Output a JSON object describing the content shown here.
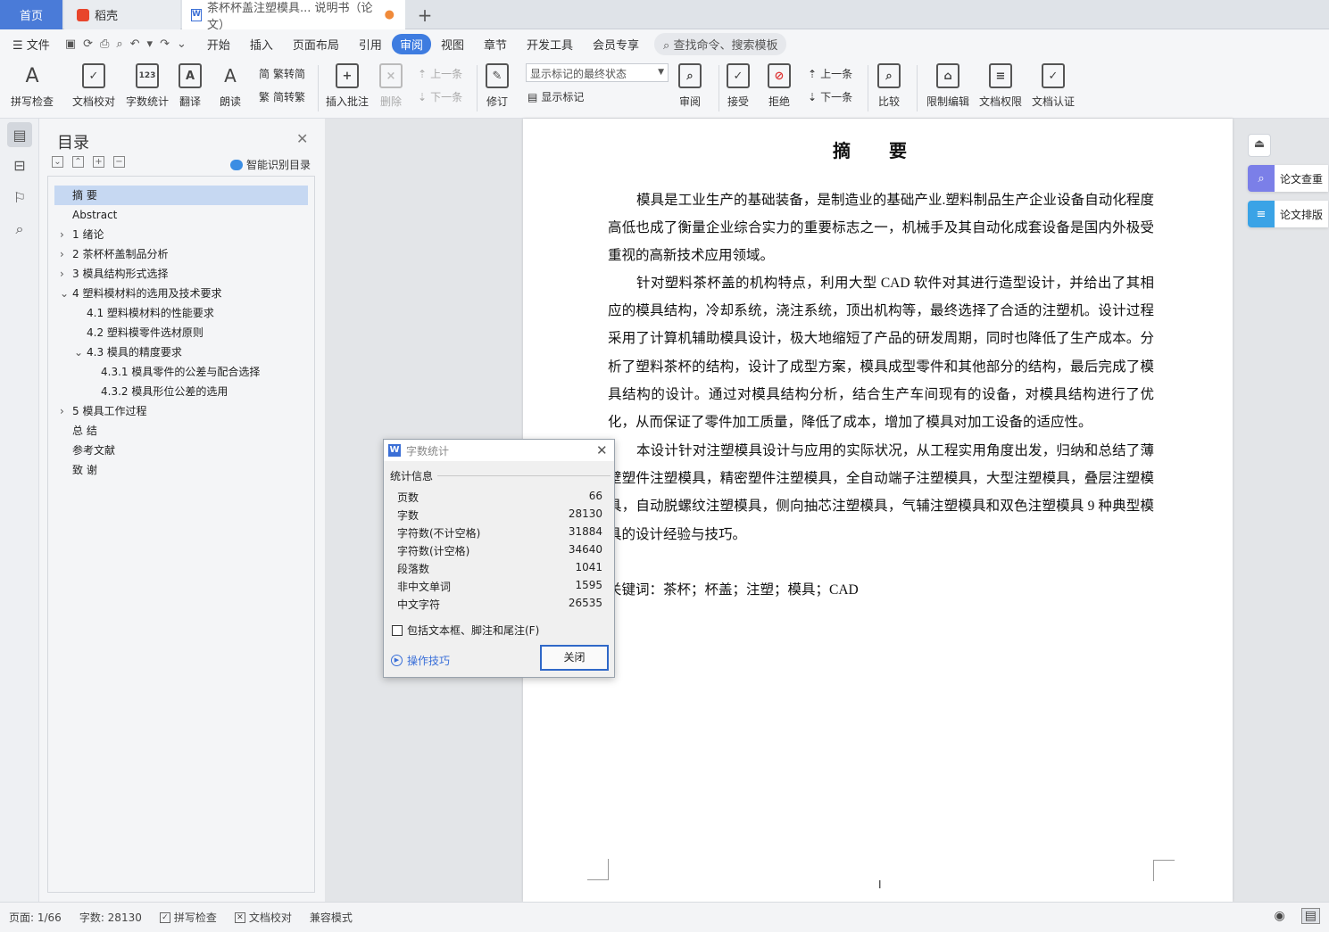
{
  "tabs": {
    "home": "首页",
    "daoke": "稻壳",
    "doc": "茶杯杯盖注塑模具... 说明书（论文）",
    "add": "+"
  },
  "menu": {
    "file": "文件",
    "items": [
      "开始",
      "插入",
      "页面布局",
      "引用",
      "审阅",
      "视图",
      "章节",
      "开发工具",
      "会员专享"
    ],
    "active": "审阅",
    "search": "查找命令、搜索模板"
  },
  "ribbon": {
    "spell": "拼写检查",
    "doc_check": "文档校对",
    "word_count": "字数统计",
    "translate": "翻译",
    "read": "朗读",
    "trad_to_simp": "繁转简",
    "simp_to_trad": "简转繁",
    "insert_comment": "插入批注",
    "delete": "删除",
    "prev": "上一条",
    "next": "下一条",
    "revise": "修订",
    "markup_mode": "显示标记的最终状态",
    "show_markup": "显示标记",
    "review": "审阅",
    "accept": "接受",
    "reject": "拒绝",
    "prev2": "上一条",
    "next2": "下一条",
    "compare": "比较",
    "restrict": "限制编辑",
    "doc_rights": "文档权限",
    "doc_cert": "文档认证"
  },
  "toc": {
    "title": "目录",
    "smart": "智能识别目录",
    "items": [
      "摘 要",
      "Abstract",
      "1 绪论",
      "2 茶杯杯盖制品分析",
      "3 模具结构形式选择",
      "4 塑料模材料的选用及技术要求",
      "4.1 塑料模材料的性能要求",
      "4.2 塑料模零件选材原则",
      "4.3 模具的精度要求",
      "4.3.1 模具零件的公差与配合选择",
      "4.3.2 模具形位公差的选用",
      "5 模具工作过程",
      "总 结",
      "参考文献",
      "致 谢"
    ]
  },
  "document": {
    "heading": "摘 要",
    "p1": "模具是工业生产的基础装备，是制造业的基础产业.塑料制品生产企业设备自动化程度高低也成了衡量企业综合实力的重要标志之一，机械手及其自动化成套设备是国内外极受重视的高新技术应用领域。",
    "p2": "针对塑料茶杯盖的机构特点，利用大型 CAD 软件对其进行造型设计，并给出了其相应的模具结构，冷却系统，浇注系统，顶出机构等，最终选择了合适的注塑机。设计过程采用了计算机辅助模具设计，极大地缩短了产品的研发周期，同时也降低了生产成本。分析了塑料茶杯的结构，设计了成型方案，模具成型零件和其他部分的结构，最后完成了模具结构的设计。通过对模具结构分析，结合生产车间现有的设备，对模具结构进行了优化，从而保证了零件加工质量，降低了成本，增加了模具对加工设备的适应性。",
    "p3": "本设计针对注塑模具设计与应用的实际状况，从工程实用角度出发，归纳和总结了薄壁塑件注塑模具，精密塑件注塑模具，全自动端子注塑模具，大型注塑模具，叠层注塑模具，自动脱螺纹注塑模具，侧向抽芯注塑模具，气辅注塑模具和双色注塑模具 9 种典型模具的设计经验与技巧。",
    "keywords": "关键词：茶杯；杯盖；注塑；模具；CAD",
    "cursor": "I"
  },
  "right_tools": {
    "dup_check": "论文查重",
    "layout": "论文排版"
  },
  "dialog": {
    "title": "字数统计",
    "legend": "统计信息",
    "stats": [
      [
        "页数",
        "66"
      ],
      [
        "字数",
        "28130"
      ],
      [
        "字符数(不计空格)",
        "31884"
      ],
      [
        "字符数(计空格)",
        "34640"
      ],
      [
        "段落数",
        "1041"
      ],
      [
        "非中文单词",
        "1595"
      ],
      [
        "中文字符",
        "26535"
      ]
    ],
    "include_label": "包括文本框、脚注和尾注(F)",
    "tips": "操作技巧",
    "close": "关闭"
  },
  "status": {
    "page": "页面: 1/66",
    "words": "字数: 28130",
    "spell": "拼写检查",
    "proof": "文档校对",
    "compat": "兼容模式"
  }
}
